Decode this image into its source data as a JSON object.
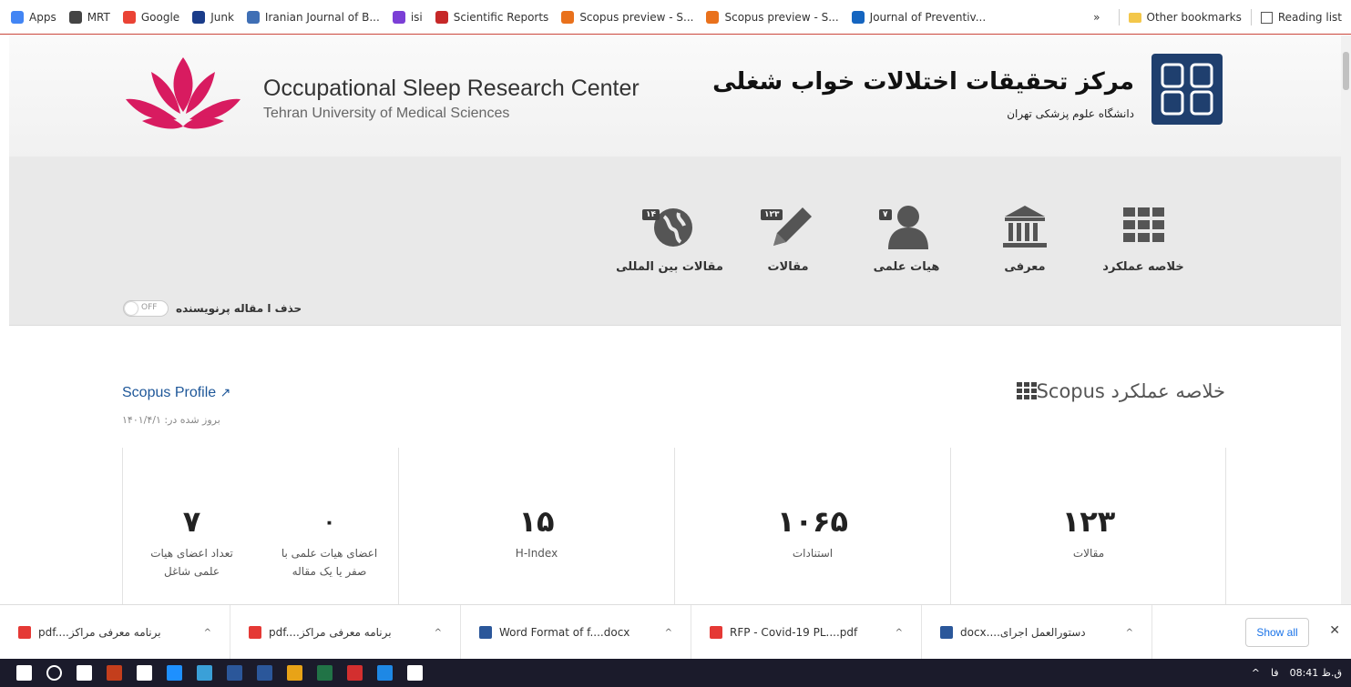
{
  "bookmarks": {
    "items": [
      {
        "label": "Apps",
        "color": "#4285f4"
      },
      {
        "label": "MRT",
        "color": "#444444"
      },
      {
        "label": "Google",
        "color": "#ea4335"
      },
      {
        "label": "Junk",
        "color": "#1a3c8a"
      },
      {
        "label": "Iranian Journal of B...",
        "color": "#3f6fb5"
      },
      {
        "label": "isi",
        "color": "#7b3fd6"
      },
      {
        "label": "Scientific Reports",
        "color": "#c62828"
      },
      {
        "label": "Scopus preview - S...",
        "color": "#e9711c"
      },
      {
        "label": "Scopus preview - S...",
        "color": "#e9711c"
      },
      {
        "label": "Journal of Preventiv...",
        "color": "#1565c0"
      }
    ],
    "overflow": "»",
    "other": "Other bookmarks",
    "reading_list": "Reading list"
  },
  "header": {
    "en_title": "Occupational Sleep Research Center",
    "en_subtitle": "Tehran University of Medical Sciences",
    "fa_title": "مرکز تحقیقات اختلالات خواب شغلی",
    "fa_subtitle": "دانشگاه علوم پزشکی تهران",
    "lotus_color": "#d81b60"
  },
  "nav": {
    "items": [
      {
        "label": "مقالات بین المللی",
        "badge": "۱۴",
        "icon": "globe-icon"
      },
      {
        "label": "مقالات",
        "badge": "۱۲۳",
        "icon": "pencil-icon"
      },
      {
        "label": "هیات علمی",
        "badge": "۷",
        "icon": "user-icon"
      },
      {
        "label": "معرفی",
        "badge": "",
        "icon": "institution-icon"
      },
      {
        "label": "خلاصه عملکرد",
        "badge": "",
        "icon": "grid-icon"
      }
    ],
    "toggle_state": "OFF",
    "toggle_label": "حذف ا مقاله پرنویسنده"
  },
  "content": {
    "scopus_link": "Scopus Profile",
    "updated": "بروز شده در: ۱۴۰۱/۴/۱",
    "section_title": "خلاصه عملکرد Scopus",
    "stats": [
      {
        "value": "۱۲۳",
        "label": "مقالات"
      },
      {
        "value": "۱۰۶۵",
        "label": "استنادات"
      },
      {
        "value": "۱۵",
        "label": "H-Index"
      }
    ],
    "faculty_stats": [
      {
        "value": "۰",
        "label": "اعضای هیات علمی با صفر یا یک مقاله"
      },
      {
        "value": "۷",
        "label": "تعداد اعضای هیات علمی شاغل"
      }
    ]
  },
  "downloads": {
    "items": [
      {
        "label": "pdf....برنامه معرفی مراکز",
        "type": "pdf"
      },
      {
        "label": "pdf....برنامه معرفی مراکز",
        "type": "pdf"
      },
      {
        "label": "Word Format of f....docx",
        "type": "word"
      },
      {
        "label": "RFP - Covid-19 PL....pdf",
        "type": "pdf"
      },
      {
        "label": "docx....دستورالعمل اجرای",
        "type": "word"
      }
    ],
    "show_all": "Show all",
    "close": "✕"
  },
  "taskbar": {
    "lang": "فا",
    "time": "08:41 ق.ظ"
  }
}
